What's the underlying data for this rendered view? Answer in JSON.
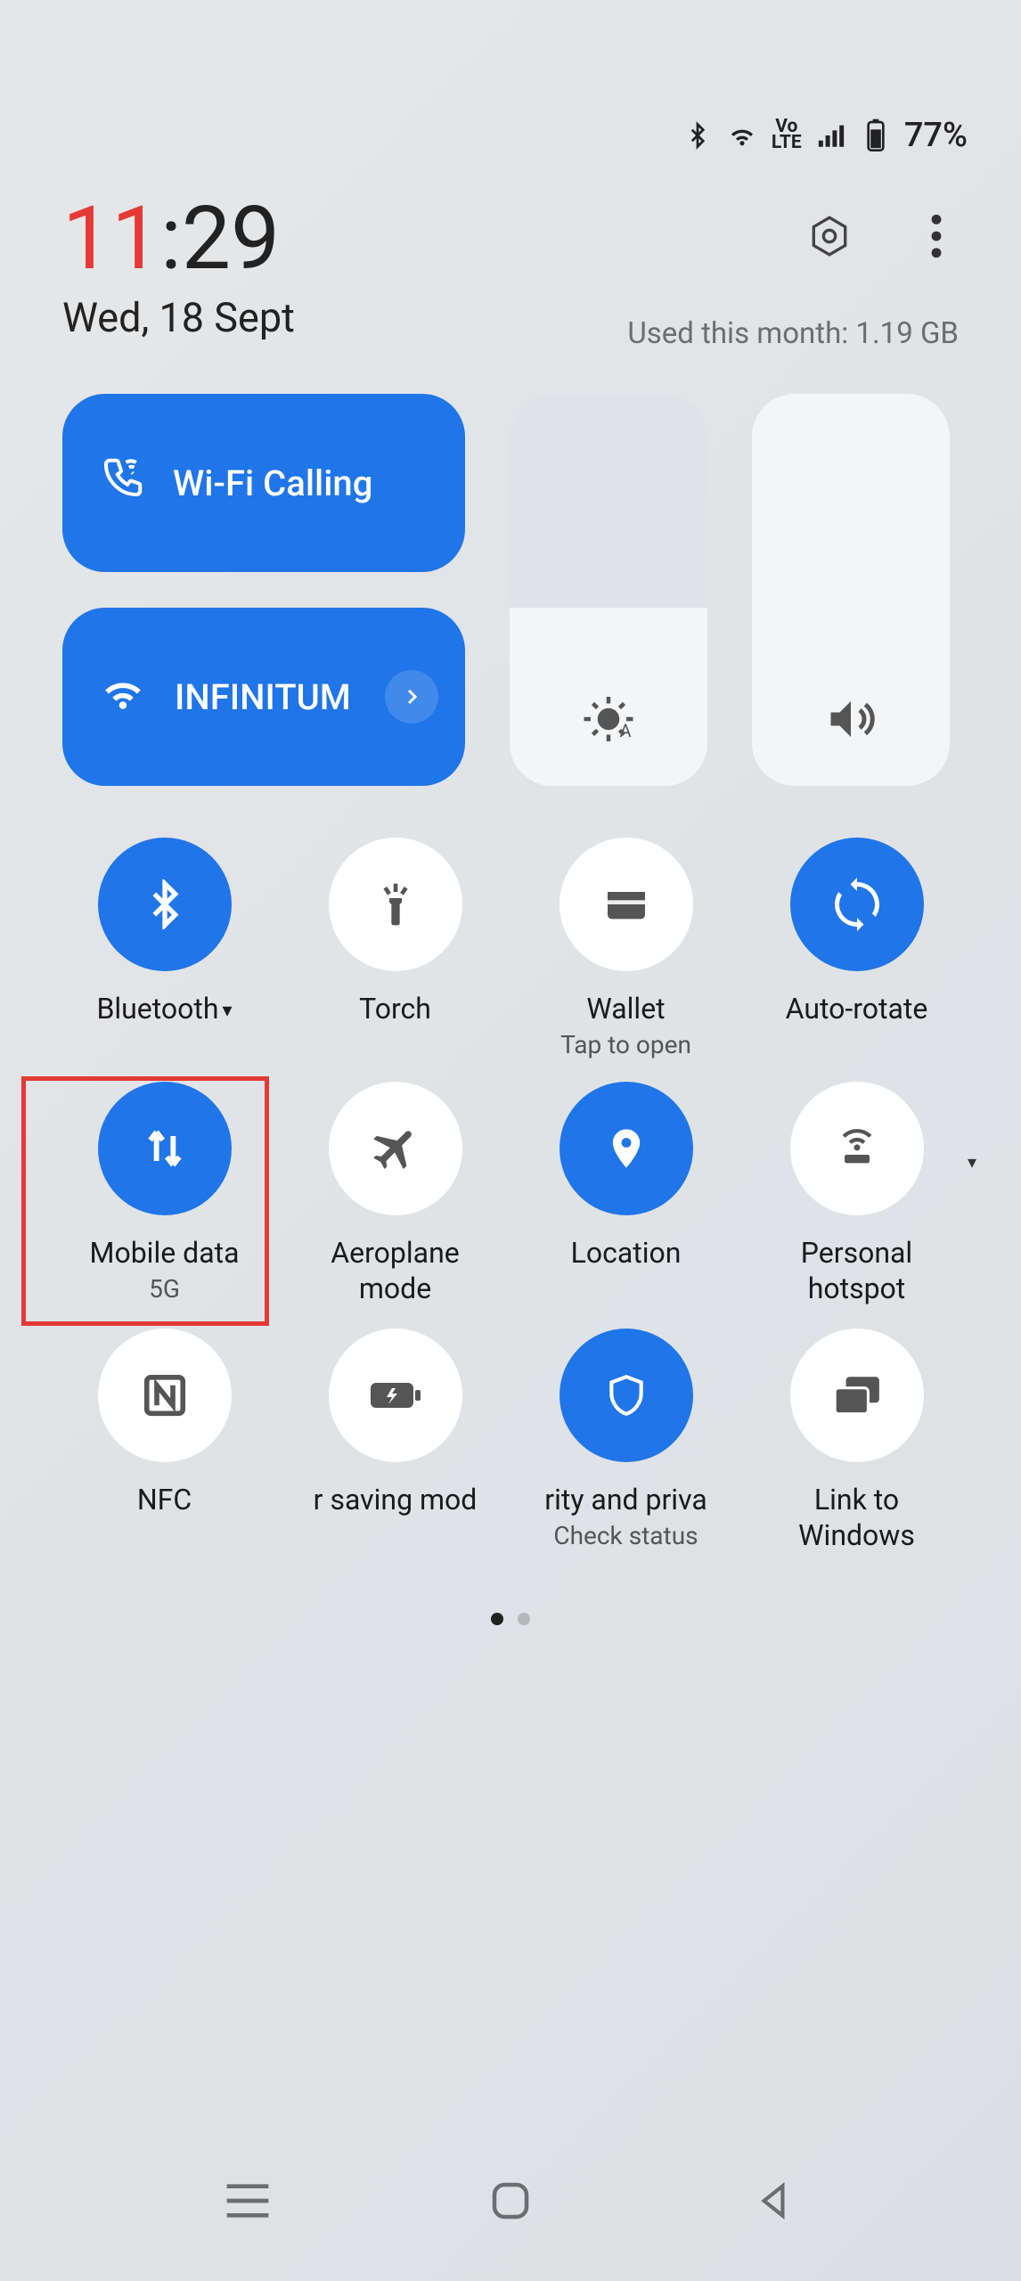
{
  "status": {
    "battery": "77%"
  },
  "clock": {
    "hour": "11",
    "rest": ":29"
  },
  "date": "Wed, 18 Sept",
  "data_usage": "Used this month: 1.19 GB",
  "pills": {
    "wifi_calling": "Wi-Fi Calling",
    "wifi_name": "INFINITUM"
  },
  "tiles": [
    {
      "label": "Bluetooth",
      "sub": "",
      "on": true,
      "icon": "bluetooth",
      "dropdown": true
    },
    {
      "label": "Torch",
      "sub": "",
      "on": false,
      "icon": "torch"
    },
    {
      "label": "Wallet",
      "sub": "Tap to open",
      "on": false,
      "icon": "wallet"
    },
    {
      "label": "Auto-rotate",
      "sub": "",
      "on": true,
      "icon": "rotate"
    },
    {
      "label": "Mobile data",
      "sub": "5G",
      "on": true,
      "icon": "data"
    },
    {
      "label": "Aeroplane mode",
      "sub": "",
      "on": false,
      "icon": "airplane"
    },
    {
      "label": "Location",
      "sub": "",
      "on": true,
      "icon": "location"
    },
    {
      "label": "Personal hotspot",
      "sub": "",
      "on": false,
      "icon": "hotspot",
      "expand": true
    },
    {
      "label": "NFC",
      "sub": "",
      "on": false,
      "icon": "nfc"
    },
    {
      "label": "r saving mod",
      "sub": "",
      "on": false,
      "icon": "battery"
    },
    {
      "label": "rity and priva",
      "sub": "Check status",
      "on": true,
      "icon": "shield"
    },
    {
      "label": "Link to Windows",
      "sub": "",
      "on": false,
      "icon": "link"
    }
  ],
  "sliders": {
    "brightness_pct": 55,
    "volume_pct": 100
  },
  "highlights": {
    "mobile_data": true
  }
}
